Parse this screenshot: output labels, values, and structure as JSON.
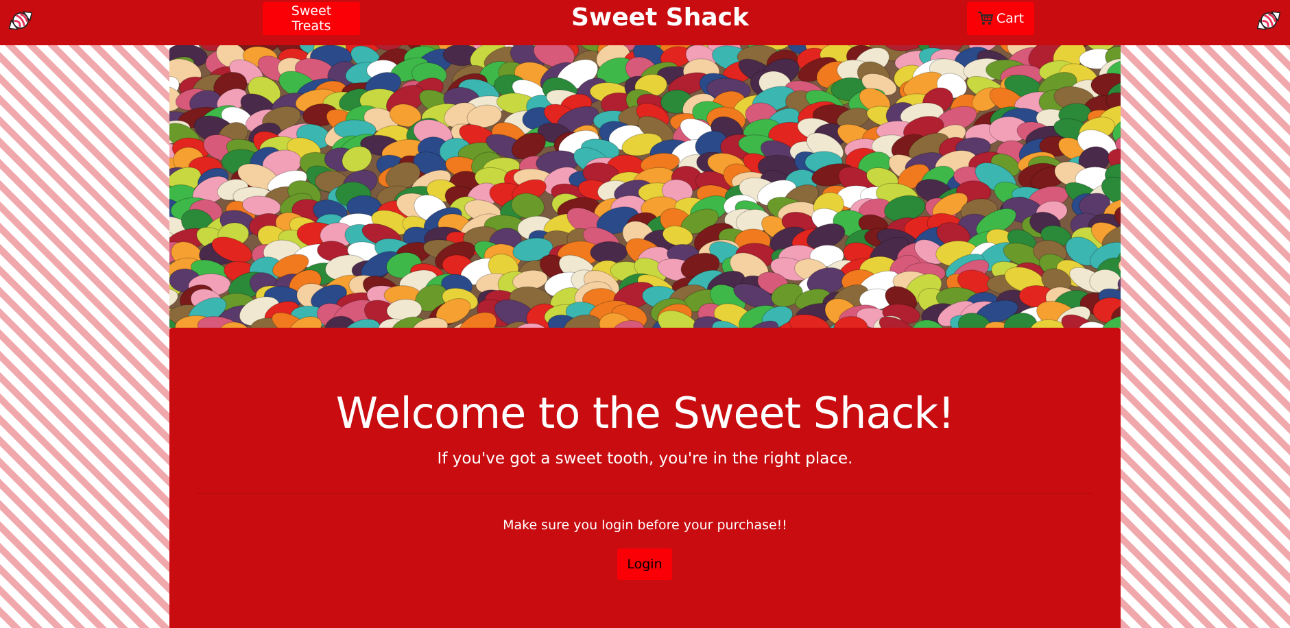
{
  "header": {
    "brand": "Sweet Shack",
    "treats_label": "Sweet Treats",
    "cart_label": "Cart",
    "logo_icon": "candy-icon",
    "cart_icon": "cart-icon",
    "bar_color": "#c80c10",
    "button_color": "#fa0006"
  },
  "hero": {
    "image": "jelly-beans-photo"
  },
  "jumbotron": {
    "title": "Welcome to the Sweet Shack!",
    "lead": "If you've got a sweet tooth, you're in the right place.",
    "note": "Make sure you login before your purchase!!",
    "login_label": "Login"
  }
}
